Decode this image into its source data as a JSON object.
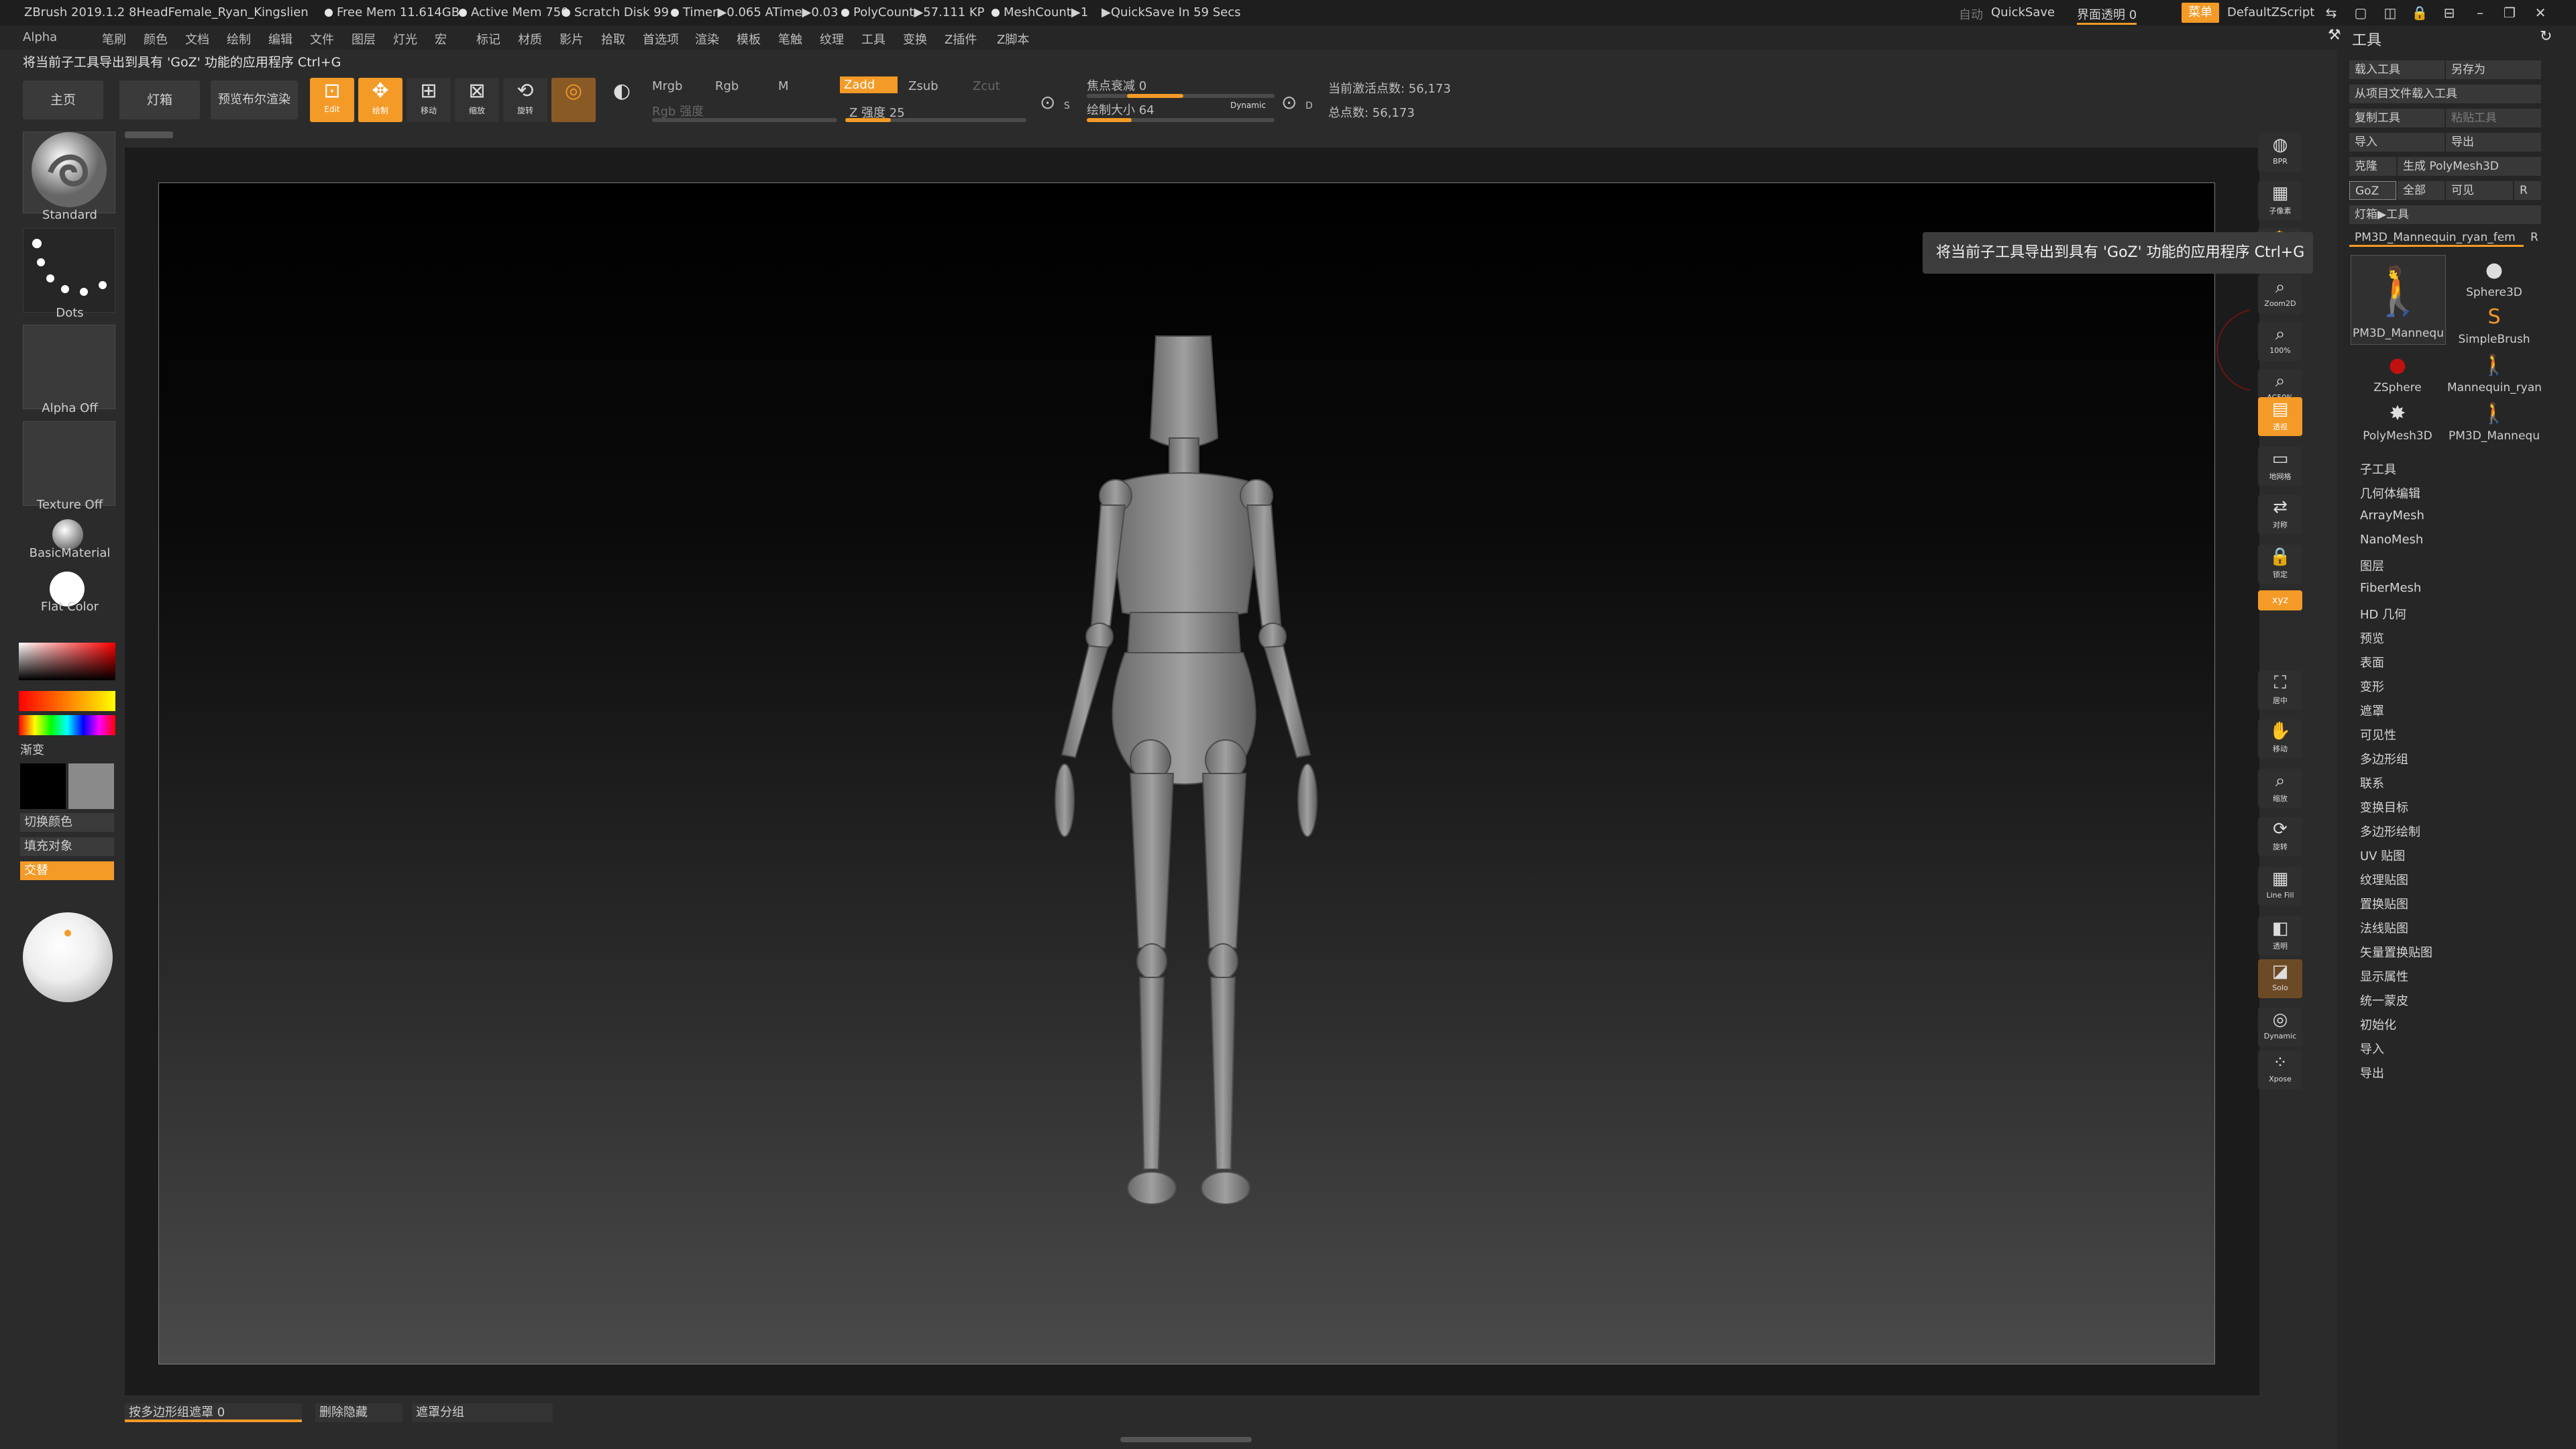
{
  "titlebar": {
    "app": "ZBrush 2019.1.2",
    "project": "8HeadFemale_Ryan_Kingslien",
    "free_mem": "Free Mem 11.614GB",
    "active_mem": "Active Mem 750",
    "scratch_disk": "Scratch Disk 99",
    "timer": "Timer▶0.065 ATime▶0.03",
    "polycount": "PolyCount▶57.111 KP",
    "meshcount": "MeshCount▶1",
    "quicksave_in": "▶QuickSave In 59 Secs",
    "auto_label": "自动",
    "quicksave": "QuickSave",
    "ui_transparency": "界面透明 0",
    "menu_chip": "菜单",
    "default_zscript": "DefaultZScript"
  },
  "menubar": {
    "items": [
      "Alpha",
      "笔刷",
      "颜色",
      "文档",
      "绘制",
      "编辑",
      "文件",
      "图层",
      "灯光",
      "宏",
      "标记",
      "材质",
      "影片",
      "拾取",
      "首选项",
      "渲染",
      "模板",
      "笔触",
      "纹理",
      "工具",
      "变换",
      "Z插件",
      "Z脚本"
    ]
  },
  "tipline": "将当前子工具导出到具有 'GoZ' 功能的应用程序 Ctrl+G",
  "toolbar": {
    "home": "主页",
    "lightbox": "灯箱",
    "bpr": "预览布尔渲染",
    "edit": "Edit",
    "draw": "绘制",
    "move": "移动",
    "scale": "缩放",
    "rotate": "旋转",
    "mrgb": "Mrgb",
    "rgb": "Rgb",
    "m": "M",
    "rgb_intensity": "Rgb 强度",
    "zadd": "Zadd",
    "zsub": "Zsub",
    "zcut": "Zcut",
    "z_intensity": "Z 强度 25",
    "focal_shift": "焦点衰减 0",
    "draw_size": "绘制大小 64",
    "dynamic": "Dynamic",
    "active_points": "当前激活点数: 56,173",
    "total_points": "总点数: 56,173",
    "focal_s": "S",
    "draw_d": "D"
  },
  "shelf": {
    "brush": "Standard",
    "stroke": "Dots",
    "alpha": "Alpha Off",
    "texture": "Texture Off",
    "material": "BasicMaterial",
    "flat_color": "Flat Color",
    "gradient": "渐变",
    "switch_color": "切换颜色",
    "fill_object": "填充对象",
    "alternate": "交替"
  },
  "bottom": {
    "poly_mask": "按多边形组遮罩 0",
    "delete_hidden": "删除隐藏",
    "mask_group": "遮罩分组"
  },
  "right_icons": [
    {
      "name": "bpr-icon",
      "label": "BPR"
    },
    {
      "name": "subpixel-icon",
      "label": "子像素"
    },
    {
      "name": "scroll-icon",
      "label": "滚动"
    },
    {
      "name": "zoom2d-icon",
      "label": "Zoom2D"
    },
    {
      "name": "actual-size-icon",
      "label": "100%"
    },
    {
      "name": "half-size-icon",
      "label": "AC50%"
    },
    {
      "name": "perspective-icon",
      "label": "透视"
    },
    {
      "name": "floor-icon",
      "label": "地网格"
    },
    {
      "name": "local-icon",
      "label": "对称"
    },
    {
      "name": "lock-icon",
      "label": "锁定"
    },
    {
      "name": "xyz-icon",
      "label": "XYZ"
    },
    {
      "name": "frame-icon",
      "label": "居中"
    },
    {
      "name": "move-view-icon",
      "label": "移动"
    },
    {
      "name": "zoom-view-icon",
      "label": "缩放"
    },
    {
      "name": "rotate-view-icon",
      "label": "旋转"
    },
    {
      "name": "line-fill-icon",
      "label": "Line Fill"
    },
    {
      "name": "transp-icon",
      "label": "透明"
    },
    {
      "name": "solo-icon",
      "label": "Solo"
    },
    {
      "name": "dynamic-icon",
      "label": "Dynamic"
    },
    {
      "name": "xpose-icon",
      "label": "Xpose"
    }
  ],
  "tool_panel": {
    "title": "工具",
    "load_tool": "载入工具",
    "save_as": "另存为",
    "load_from_project": "从项目文件载入工具",
    "copy_tool": "复制工具",
    "paste_tool": "粘贴工具",
    "import": "导入",
    "export": "导出",
    "clone": "克隆",
    "make_polymesh": "生成 PolyMesh3D",
    "goz": "GoZ",
    "all": "全部",
    "visible": "可见",
    "r": "R",
    "lightbox_tools": "灯箱▶工具",
    "current_tool": "PM3D_Mannequin_ryan_fem",
    "tools": [
      {
        "name": "PM3D_Mannequ",
        "icon": "mannequin"
      },
      {
        "name": "Sphere3D",
        "icon": "sphere"
      },
      {
        "name": "SimpleBrush",
        "icon": "brush"
      },
      {
        "name": "ZSphere",
        "icon": "zsphere"
      },
      {
        "name": "Mannequin_ryan",
        "icon": "mannequin"
      },
      {
        "name": "PolyMesh3D",
        "icon": "star"
      },
      {
        "name": "PM3D_Mannequ",
        "icon": "mannequin"
      }
    ],
    "sections": [
      "子工具",
      "几何体编辑",
      "ArrayMesh",
      "NanoMesh",
      "图层",
      "FiberMesh",
      "HD 几何",
      "预览",
      "表面",
      "变形",
      "遮罩",
      "可见性",
      "多边形组",
      "联系",
      "变换目标",
      "多边形绘制",
      "UV 贴图",
      "纹理贴图",
      "置换贴图",
      "法线贴图",
      "矢量置换贴图",
      "显示属性",
      "统一蒙皮",
      "初始化",
      "导入",
      "导出"
    ]
  },
  "tooltip": "将当前子工具导出到具有 'GoZ' 功能的应用程序  Ctrl+G",
  "accent_color": "#f39a27"
}
